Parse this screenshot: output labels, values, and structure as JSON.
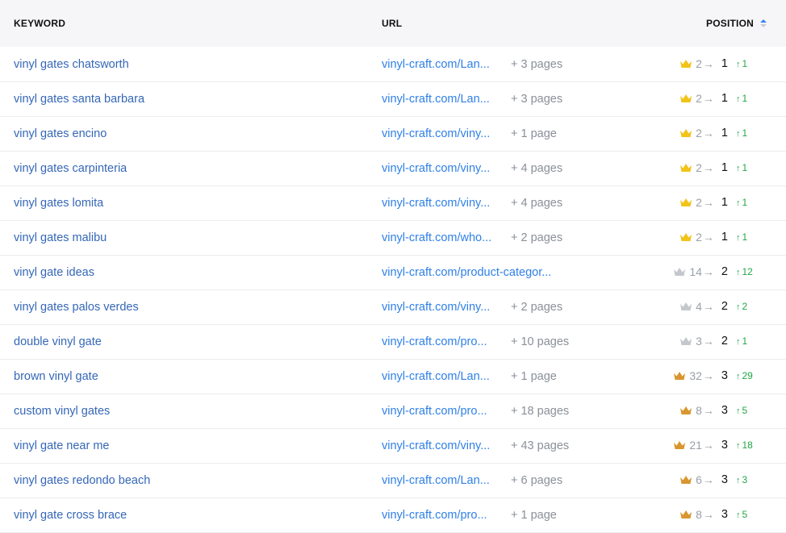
{
  "columns": {
    "keyword": "KEYWORD",
    "url": "URL",
    "position": "POSITION"
  },
  "colors": {
    "crown_gold": "#f2c318",
    "crown_silver": "#c4c7cc",
    "crown_bronze": "#d9962f",
    "link_blue": "#3567b7",
    "url_blue": "#2f80e6",
    "change_green": "#22a745"
  },
  "rows": [
    {
      "keyword": "vinyl gates chatsworth",
      "url": "vinyl-craft.com/Lan...",
      "pages": "+ 3 pages",
      "medal": "gold",
      "prev": "2",
      "arrow": "→",
      "current": "1",
      "change_arrow": "↑",
      "change": "1"
    },
    {
      "keyword": "vinyl gates santa barbara",
      "url": "vinyl-craft.com/Lan...",
      "pages": "+ 3 pages",
      "medal": "gold",
      "prev": "2",
      "arrow": "→",
      "current": "1",
      "change_arrow": "↑",
      "change": "1"
    },
    {
      "keyword": "vinyl gates encino",
      "url": "vinyl-craft.com/viny...",
      "pages": "+ 1 page",
      "medal": "gold",
      "prev": "2",
      "arrow": "→",
      "current": "1",
      "change_arrow": "↑",
      "change": "1"
    },
    {
      "keyword": "vinyl gates carpinteria",
      "url": "vinyl-craft.com/viny...",
      "pages": "+ 4 pages",
      "medal": "gold",
      "prev": "2",
      "arrow": "→",
      "current": "1",
      "change_arrow": "↑",
      "change": "1"
    },
    {
      "keyword": "vinyl gates lomita",
      "url": "vinyl-craft.com/viny...",
      "pages": "+ 4 pages",
      "medal": "gold",
      "prev": "2",
      "arrow": "→",
      "current": "1",
      "change_arrow": "↑",
      "change": "1"
    },
    {
      "keyword": "vinyl gates malibu",
      "url": "vinyl-craft.com/who...",
      "pages": "+ 2 pages",
      "medal": "gold",
      "prev": "2",
      "arrow": "→",
      "current": "1",
      "change_arrow": "↑",
      "change": "1"
    },
    {
      "keyword": "vinyl gate ideas",
      "url": "vinyl-craft.com/product-categor...",
      "pages": "",
      "medal": "silver",
      "prev": "14",
      "arrow": "→",
      "current": "2",
      "change_arrow": "↑",
      "change": "12"
    },
    {
      "keyword": "vinyl gates palos verdes",
      "url": "vinyl-craft.com/viny...",
      "pages": "+ 2 pages",
      "medal": "silver",
      "prev": "4",
      "arrow": "→",
      "current": "2",
      "change_arrow": "↑",
      "change": "2"
    },
    {
      "keyword": "double vinyl gate",
      "url": "vinyl-craft.com/pro...",
      "pages": "+ 10 pages",
      "medal": "silver",
      "prev": "3",
      "arrow": "→",
      "current": "2",
      "change_arrow": "↑",
      "change": "1"
    },
    {
      "keyword": "brown vinyl gate",
      "url": "vinyl-craft.com/Lan...",
      "pages": "+ 1 page",
      "medal": "bronze",
      "prev": "32",
      "arrow": "→",
      "current": "3",
      "change_arrow": "↑",
      "change": "29"
    },
    {
      "keyword": "custom vinyl gates",
      "url": "vinyl-craft.com/pro...",
      "pages": "+ 18 pages",
      "medal": "bronze",
      "prev": "8",
      "arrow": "→",
      "current": "3",
      "change_arrow": "↑",
      "change": "5"
    },
    {
      "keyword": "vinyl gate near me",
      "url": "vinyl-craft.com/viny...",
      "pages": "+ 43 pages",
      "medal": "bronze",
      "prev": "21",
      "arrow": "→",
      "current": "3",
      "change_arrow": "↑",
      "change": "18"
    },
    {
      "keyword": "vinyl gates redondo beach",
      "url": "vinyl-craft.com/Lan...",
      "pages": "+ 6 pages",
      "medal": "bronze",
      "prev": "6",
      "arrow": "→",
      "current": "3",
      "change_arrow": "↑",
      "change": "3"
    },
    {
      "keyword": "vinyl gate cross brace",
      "url": "vinyl-craft.com/pro...",
      "pages": "+ 1 page",
      "medal": "bronze",
      "prev": "8",
      "arrow": "→",
      "current": "3",
      "change_arrow": "↑",
      "change": "5"
    }
  ]
}
